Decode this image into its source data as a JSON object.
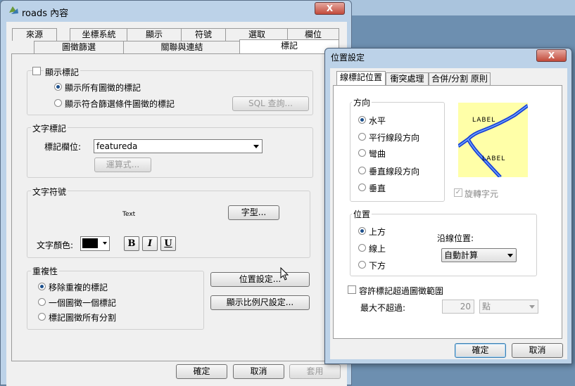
{
  "main_window": {
    "title": "roads 內容",
    "close": "X",
    "tabs_row1": [
      "來源",
      "坐標系統",
      "顯示",
      "符號",
      "選取",
      "欄位"
    ],
    "tabs_row2": [
      "圖徵篩選",
      "關聯與連結",
      "標記"
    ],
    "show_labels": "顯示標記",
    "radio_all": "顯示所有圖徵的標記",
    "radio_filter": "顯示符合篩選條件圖徵的標記",
    "sql_button": "SQL 查詢...",
    "text_label_group": "文字標記",
    "label_field_label": "標記欄位:",
    "label_field_value": "featureda",
    "expression_button": "運算式...",
    "text_symbol_group": "文字符號",
    "preview_text": "Text",
    "font_button": "字型...",
    "text_color_label": "文字顏色:",
    "bold": "B",
    "italic": "I",
    "underline": "U",
    "duplicates_group": "重複性",
    "dup_remove": "移除重複的標記",
    "dup_one": "一個圖徵一個標記",
    "dup_all": "標記圖徵所有分割",
    "placement_button": "位置設定...",
    "scale_button": "顯示比例尺設定...",
    "ok": "確定",
    "cancel": "取消",
    "apply": "套用"
  },
  "placement_window": {
    "title": "位置設定",
    "close": "X",
    "tabs": [
      "線標記位置",
      "衝突處理",
      "合併/分割 原則"
    ],
    "direction_group": "方向",
    "dir_options": [
      "水平",
      "平行線段方向",
      "彎曲",
      "垂直線段方向",
      "垂直"
    ],
    "preview_label1": "LABEL",
    "preview_label2": "LABEL",
    "rotate_chars": "旋轉字元",
    "position_group": "位置",
    "pos_options": [
      "上方",
      "線上",
      "下方"
    ],
    "along_line_label": "沿線位置:",
    "along_line_value": "自動計算",
    "allow_overrun": "容許標記超過圖徵範圍",
    "max_label": "最大不超過:",
    "max_value": "20",
    "unit_value": "點",
    "ok": "確定",
    "cancel": "取消"
  },
  "colors": {
    "text_color": "#000000",
    "preview_bg": "#ffffa8",
    "road_color": "#1a3fd6"
  }
}
